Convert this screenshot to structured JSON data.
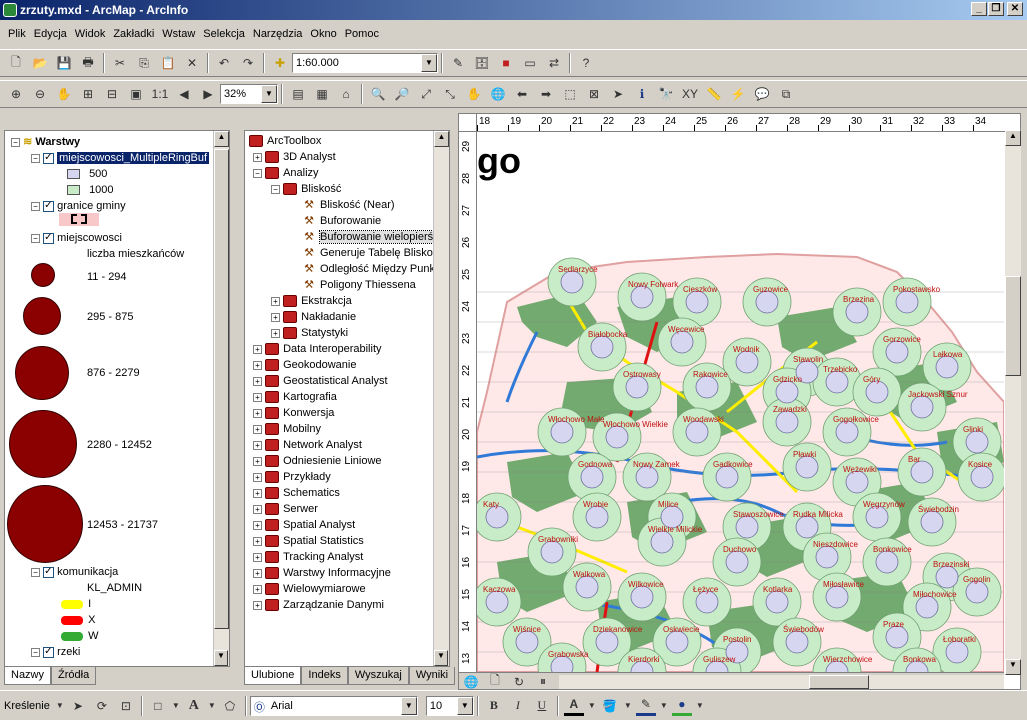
{
  "window": {
    "title": "zrzuty.mxd - ArcMap - ArcInfo"
  },
  "menu": [
    "Plik",
    "Edycja",
    "Widok",
    "Zakładki",
    "Wstaw",
    "Selekcja",
    "Narzędzia",
    "Okno",
    "Pomoc"
  ],
  "toolbar": {
    "scale_value": "1:60.000",
    "zoom_value": "32%"
  },
  "toc": {
    "root": "Warstwy",
    "layer1": {
      "name": "miejscowosci_MultipleRingBuf",
      "classes": [
        "500",
        "1000"
      ],
      "colors": [
        "#d6d6f0",
        "#c8ecc8"
      ]
    },
    "layer2": {
      "name": "granice gminy"
    },
    "layer3": {
      "name": "miejscowosci",
      "field": "liczba mieszkańców",
      "classes": [
        "11 - 294",
        "295 - 875",
        "876 - 2279",
        "2280 - 12452",
        "12453 - 21737"
      ]
    },
    "layer4": {
      "name": "komunikacja",
      "field": "KL_ADMIN",
      "classes": [
        "I",
        "X",
        "W"
      ],
      "colors": [
        "#ffff00",
        "#ff0000",
        "#33aa33"
      ]
    },
    "layer5": {
      "name": "rzeki"
    },
    "tabs": [
      "Nazwy",
      "Źródła"
    ]
  },
  "toolbox": {
    "root": "ArcToolbox",
    "items": [
      {
        "label": "3D Analyst",
        "level": 1,
        "kind": "box"
      },
      {
        "label": "Analizy",
        "level": 1,
        "kind": "box"
      },
      {
        "label": "Bliskość",
        "level": 2,
        "kind": "box"
      },
      {
        "label": "Bliskość (Near)",
        "level": 3,
        "kind": "tool"
      },
      {
        "label": "Buforowanie",
        "level": 3,
        "kind": "tool"
      },
      {
        "label": "Buforowanie wielopierście",
        "level": 3,
        "kind": "tool"
      },
      {
        "label": "Generuje Tabelę Bliskości",
        "level": 3,
        "kind": "tool"
      },
      {
        "label": "Odległość Między Punktami",
        "level": 3,
        "kind": "tool"
      },
      {
        "label": "Poligony Thiessena",
        "level": 3,
        "kind": "tool"
      },
      {
        "label": "Ekstrakcja",
        "level": 2,
        "kind": "box"
      },
      {
        "label": "Nakładanie",
        "level": 2,
        "kind": "box"
      },
      {
        "label": "Statystyki",
        "level": 2,
        "kind": "box"
      },
      {
        "label": "Data Interoperability",
        "level": 1,
        "kind": "box"
      },
      {
        "label": "Geokodowanie",
        "level": 1,
        "kind": "box"
      },
      {
        "label": "Geostatistical Analyst",
        "level": 1,
        "kind": "box"
      },
      {
        "label": "Kartografia",
        "level": 1,
        "kind": "box"
      },
      {
        "label": "Konwersja",
        "level": 1,
        "kind": "box"
      },
      {
        "label": "Mobilny",
        "level": 1,
        "kind": "box"
      },
      {
        "label": "Network Analyst",
        "level": 1,
        "kind": "box"
      },
      {
        "label": "Odniesienie Liniowe",
        "level": 1,
        "kind": "box"
      },
      {
        "label": "Przykłady",
        "level": 1,
        "kind": "box"
      },
      {
        "label": "Schematics",
        "level": 1,
        "kind": "box"
      },
      {
        "label": "Serwer",
        "level": 1,
        "kind": "box"
      },
      {
        "label": "Spatial Analyst",
        "level": 1,
        "kind": "box"
      },
      {
        "label": "Spatial Statistics",
        "level": 1,
        "kind": "box"
      },
      {
        "label": "Tracking Analyst",
        "level": 1,
        "kind": "box"
      },
      {
        "label": "Warstwy Informacyjne",
        "level": 1,
        "kind": "box"
      },
      {
        "label": "Wielowymiarowe",
        "level": 1,
        "kind": "box"
      },
      {
        "label": "Zarządzanie Danymi",
        "level": 1,
        "kind": "box"
      }
    ],
    "tabs": [
      "Ulubione",
      "Indeks",
      "Wyszukaj",
      "Wyniki"
    ]
  },
  "map": {
    "title_fragment": "go",
    "ruler_top": [
      "18",
      "19",
      "20",
      "21",
      "22",
      "23",
      "24",
      "25",
      "26",
      "27",
      "28",
      "29",
      "30",
      "31",
      "32",
      "33",
      "34"
    ],
    "ruler_left": [
      "29",
      "28",
      "27",
      "26",
      "25",
      "24",
      "23",
      "22",
      "21",
      "20",
      "19",
      "18",
      "17",
      "16",
      "15",
      "14",
      "13"
    ],
    "places": [
      "Sedlarzyce",
      "Nowy Folwark",
      "Cieszków",
      "Guzowice",
      "Brzezina",
      "Pokostawsko",
      "Białobocka",
      "Węcewice",
      "Wodnik",
      "Stawolin",
      "Gorzowice",
      "Lałkowa",
      "Ostrowasy",
      "Rakowice",
      "Gdzicko",
      "Trzebicko",
      "Góry",
      "Jackowski Sznur",
      "Włochowo Małe",
      "Włochowo Wielkie",
      "Woodawski",
      "Zawadzki",
      "Gogołkowice",
      "Glinki",
      "Godnowa",
      "Nowy Zamek",
      "Gadkowice",
      "Pławki",
      "Wężewiki",
      "Bar",
      "Kosice",
      "Katy",
      "Wrobie",
      "Milice",
      "Stawoszowice",
      "Rudka Milicka",
      "Węgrzynów",
      "Świebodzin",
      "Grabowniki",
      "Wielkie Milickie",
      "Duchowo",
      "Nieszdowice",
      "Bonkowice",
      "Brzezinski",
      "Kaczowa",
      "Walkowa",
      "Wilkowice",
      "Łężyce",
      "Kotlarka",
      "Miłosławice",
      "Miłochowice",
      "Gogolin",
      "Wiśnice",
      "Dziekanowice",
      "Oskwiecie",
      "Postolin",
      "Świebodów",
      "Praze",
      "Łoboratki",
      "Grabowska",
      "Kierdorki",
      "Guliszew",
      "Wierzchowice",
      "Bonkowa"
    ]
  },
  "drawbar": {
    "label": "Kreślenie",
    "font_value": "Arial",
    "size_value": "10"
  }
}
